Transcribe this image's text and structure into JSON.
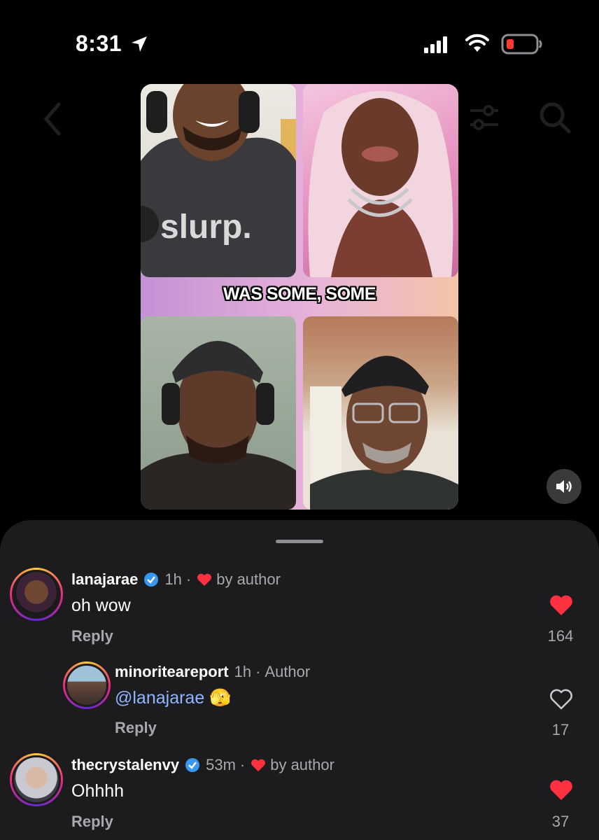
{
  "status_bar": {
    "time": "8:31"
  },
  "video": {
    "caption": "WAS SOME, SOME",
    "shirt_text": "slurp."
  },
  "comments": [
    {
      "username": "lanajarae",
      "verified": true,
      "time": "1h",
      "separator": "·",
      "badge": "by author",
      "liked_by_author": true,
      "text": "oh wow",
      "reply_label": "Reply",
      "likes": "164",
      "liked": true
    },
    {
      "username": "minoriteareport",
      "verified": false,
      "time": "1h",
      "separator": "·",
      "badge": "Author",
      "text_mention": "@lanajarae",
      "text_emoji": "🫣",
      "reply_label": "Reply",
      "likes": "17",
      "liked": false
    },
    {
      "username": "thecrystalenvy",
      "verified": true,
      "time": "53m",
      "separator": "·",
      "badge": "by author",
      "liked_by_author": true,
      "text": "Ohhhh",
      "reply_label": "Reply",
      "likes": "37",
      "liked": true
    }
  ]
}
